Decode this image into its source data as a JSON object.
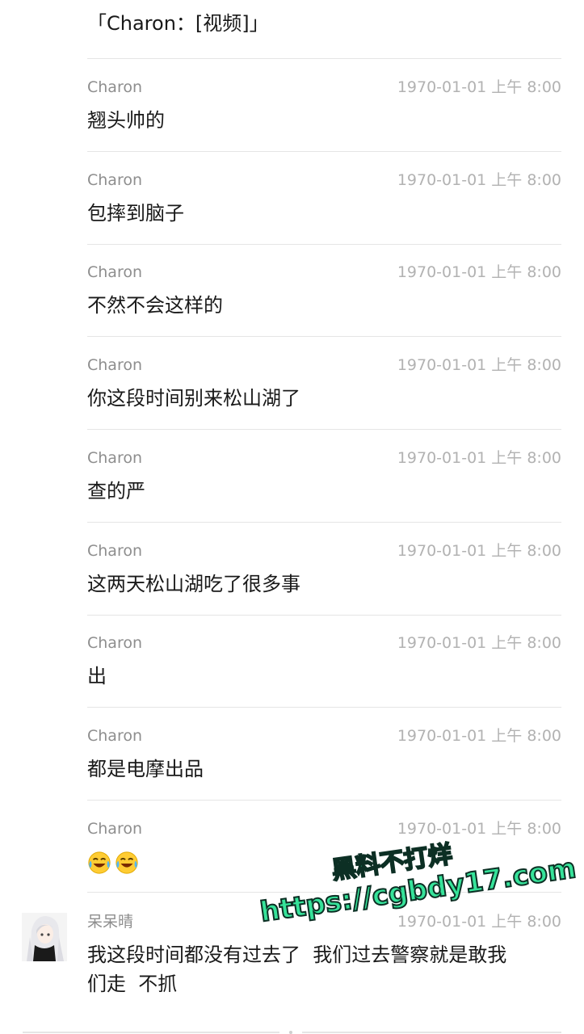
{
  "quoted_message": "「Charon：[视频]」",
  "messages": [
    {
      "sender": "Charon",
      "time": "1970-01-01 上午 8:00",
      "text": "翘头帅的"
    },
    {
      "sender": "Charon",
      "time": "1970-01-01 上午 8:00",
      "text": "包摔到脑子"
    },
    {
      "sender": "Charon",
      "time": "1970-01-01 上午 8:00",
      "text": "不然不会这样的"
    },
    {
      "sender": "Charon",
      "time": "1970-01-01 上午 8:00",
      "text": "你这段时间别来松山湖了"
    },
    {
      "sender": "Charon",
      "time": "1970-01-01 上午 8:00",
      "text": "查的严"
    },
    {
      "sender": "Charon",
      "time": "1970-01-01 上午 8:00",
      "text": "这两天松山湖吃了很多事"
    },
    {
      "sender": "Charon",
      "time": "1970-01-01 上午 8:00",
      "text": "出"
    },
    {
      "sender": "Charon",
      "time": "1970-01-01 上午 8:00",
      "text": "都是电摩出品"
    },
    {
      "sender": "Charon",
      "time": "1970-01-01 上午 8:00",
      "emoji": [
        "laugh-cry-emoji",
        "laugh-cry-emoji"
      ]
    },
    {
      "sender": "呆呆晴",
      "time": "1970-01-01 上午 8:00",
      "text_line1": "我这段时间都没有过去了  我们过去警察就是敢我",
      "text_line2": "们走  不抓",
      "avatar": "anime-girl-avatar"
    }
  ],
  "watermark": {
    "line1": "黑料不打烊",
    "line2": "https://cgbdy17.com"
  },
  "colors": {
    "sender": "#8e8e8e",
    "time": "#b2b2b2",
    "text": "#191919",
    "divider": "#e5e5e5",
    "watermark_fill": "#36e39a",
    "watermark_stroke": "#0c2f24"
  }
}
